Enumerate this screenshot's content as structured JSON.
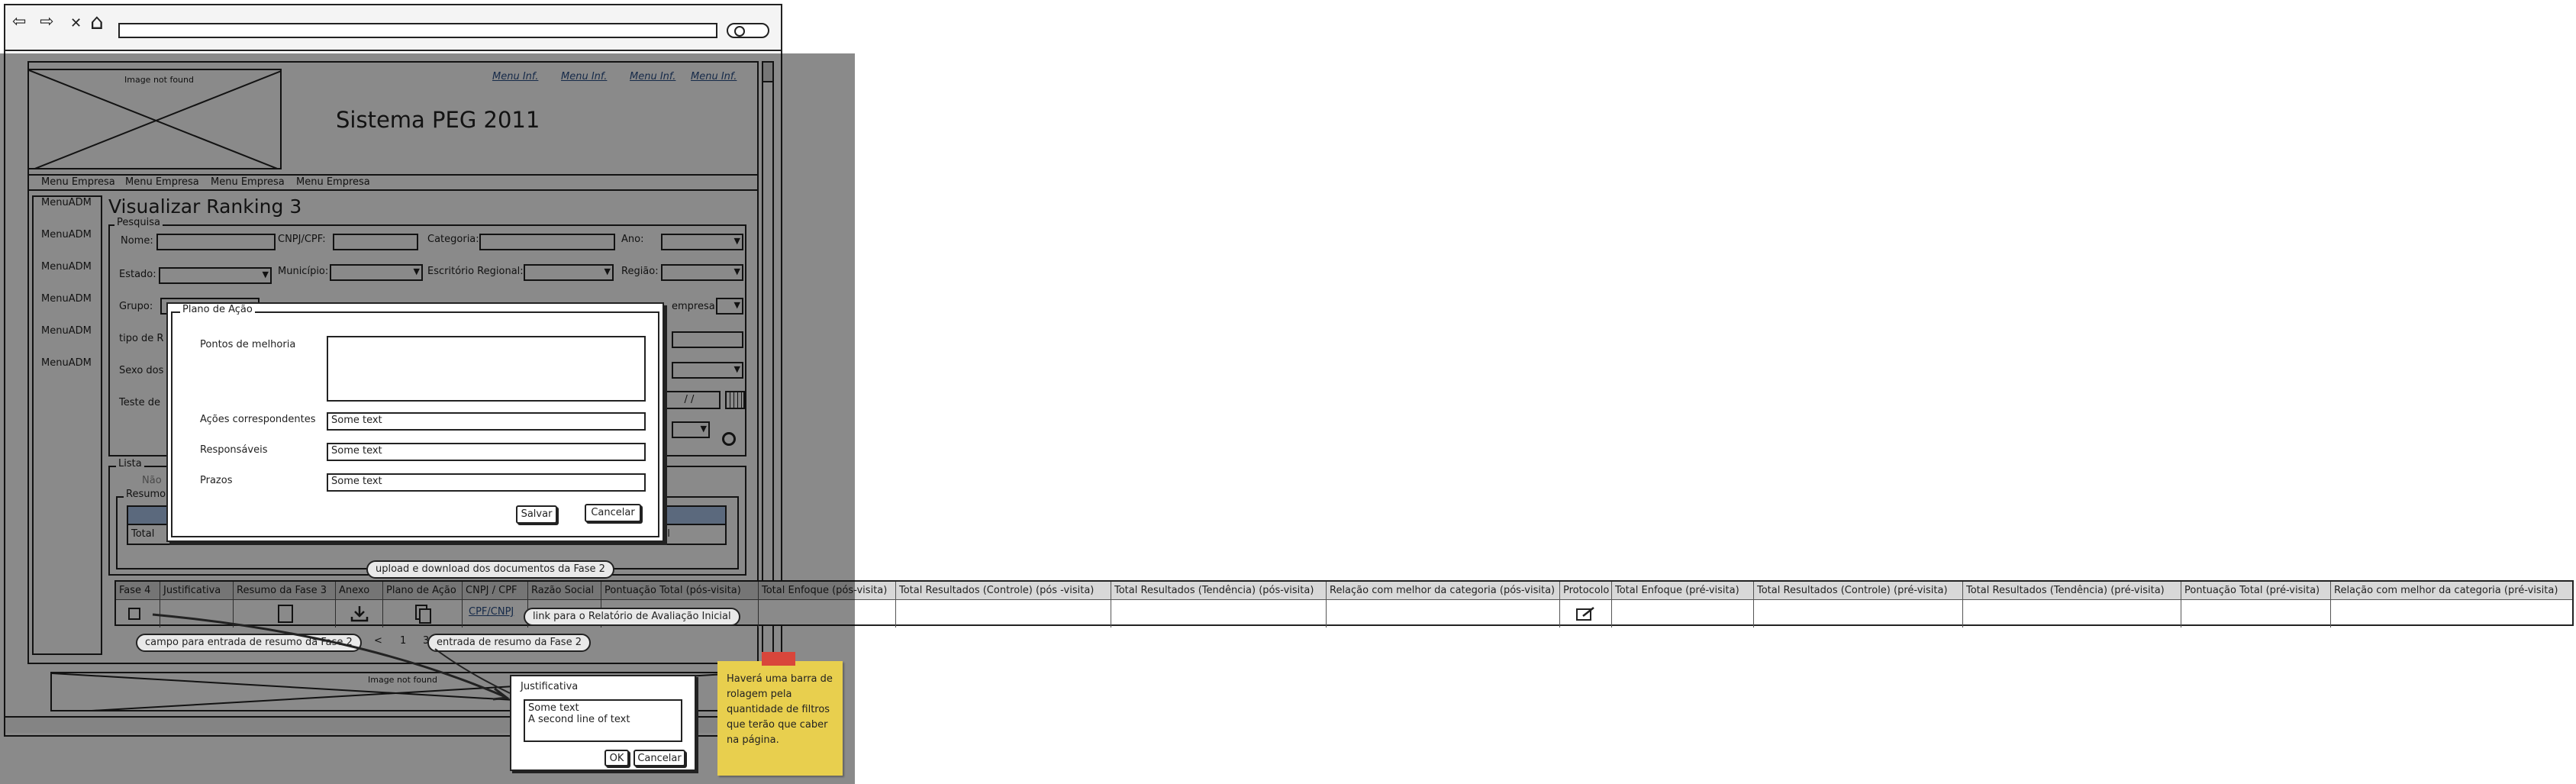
{
  "browser": {
    "nav_back": "⇦",
    "nav_fwd": "⇨",
    "nav_close": "✕",
    "nav_home": "⌂",
    "url": ""
  },
  "header": {
    "logo_text": "Image not found",
    "title": "Sistema PEG 2011",
    "top_links": [
      "Menu Inf.",
      "Menu Inf.",
      "Menu Inf.",
      "Menu Inf."
    ]
  },
  "menu": [
    "Menu Empresa",
    "Menu Empresa",
    "Menu Empresa",
    "Menu Empresa"
  ],
  "sidebar": [
    "MenuADM",
    "MenuADM",
    "MenuADM",
    "MenuADM",
    "MenuADM",
    "MenuADM"
  ],
  "page_title": "Visualizar Ranking 3",
  "search": {
    "legend": "Pesquisa",
    "labels": {
      "nome": "Nome:",
      "cnpj": "CNPJ/CPF:",
      "categoria": "Categoria:",
      "ano": "Ano:",
      "estado": "Estado:",
      "municipio": "Município:",
      "escritorio": "Escritório Regional:",
      "regiao": "Região:",
      "grupo": "Grupo:",
      "empresa": "empresa:",
      "tipo": "tipo de R",
      "sexo": "Sexo dos",
      "teste": "Teste de"
    },
    "date_value": "/ /"
  },
  "lista": {
    "legend": "Lista",
    "nao": "Não",
    "resumo": "Resumo",
    "total": "Total",
    "nal": "nal"
  },
  "dialog": {
    "legend": "Plano de Ação",
    "pontos_label": "Pontos de melhoria",
    "acoes_label": "Ações correspondentes",
    "acoes_value": "Some text",
    "resp_label": "Responsáveis",
    "resp_value": "Some text",
    "prazos_label": "Prazos",
    "prazos_value": "Some text",
    "save": "Salvar",
    "cancel": "Cancelar"
  },
  "table": {
    "headers": [
      "Fase 4",
      "Justificativa",
      "Resumo da Fase 3",
      "Anexo",
      "Plano de Ação",
      "CNPJ / CPF",
      "Razão Social",
      "Pontuação Total (pós-visita)",
      "Total Enfoque (pós-visita)",
      "Total Resultados (Controle) (pós -visita)",
      "Total Resultados (Tendência) (pós-visita)",
      "Relação com melhor da categoria (pós-visita)",
      "Protocolo",
      "Total Enfoque (pré-visita)",
      "Total Resultados (Controle) (pré-visita)",
      "Total Resultados (Tendência) (pré-visita)",
      "Pontuação Total (pré-visita)",
      "Relação com melhor da categoria (pré-visita)"
    ],
    "cnpj_link": "CPF/CNPJ"
  },
  "pagination": {
    "left": "<",
    "page": "1",
    "right": "3"
  },
  "callouts": {
    "upload": "upload e download dos documentos da Fase 2",
    "link": "link para o Relatório de Avaliação Inicial",
    "campo": "campo para entrada de resumo da Fase 2",
    "entrada": "entrada de resumo da Fase 2"
  },
  "footer_image": "Image not found",
  "justificativa": {
    "title": "Justificativa",
    "line1": "Some text",
    "line2": "A second line of text",
    "ok": "OK",
    "cancel": "Cancelar"
  },
  "note": "Haverá uma barra de rolagem pela quantidade de filtros que terão que caber na página.",
  "colors": {
    "overlay": "#757575",
    "note": "#e8cf4e",
    "note_tab": "#d9463b",
    "link": "#2a4f87",
    "header_row": "#d8d8d8"
  }
}
